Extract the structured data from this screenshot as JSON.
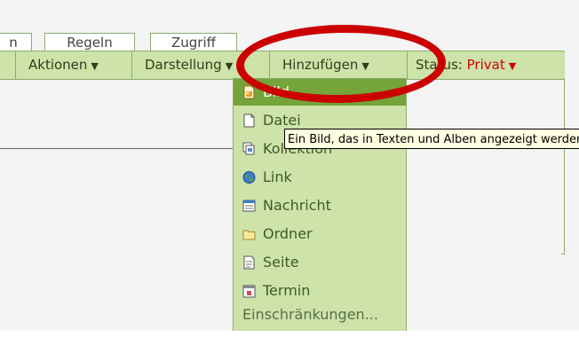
{
  "tabs": [
    {
      "label": "n"
    },
    {
      "label": "Regeln"
    },
    {
      "label": "Zugriff"
    }
  ],
  "menubar": {
    "aktionen": "Aktionen",
    "darstellung": "Darstellung",
    "hinzufuegen": "Hinzufügen",
    "status_label": "Status:",
    "status_value": "Privat",
    "arrow": "▼"
  },
  "dropdown": {
    "items": [
      {
        "label": "Bild",
        "icon": "image-file-icon"
      },
      {
        "label": "Datei",
        "icon": "file-icon"
      },
      {
        "label": "Kollektion",
        "icon": "collection-icon"
      },
      {
        "label": "Link",
        "icon": "globe-link-icon"
      },
      {
        "label": "Nachricht",
        "icon": "news-icon"
      },
      {
        "label": "Ordner",
        "icon": "folder-icon"
      },
      {
        "label": "Seite",
        "icon": "page-icon"
      },
      {
        "label": "Termin",
        "icon": "calendar-icon"
      }
    ],
    "restrictions": "Einschränkungen..."
  },
  "tooltip": {
    "text": "Ein Bild, das in Texten und Alben angezeigt werden kann."
  },
  "colors": {
    "menu_bg": "#cde3a9",
    "menu_border": "#8cac6c",
    "selected_bg": "#74a43a",
    "status_red": "#d40000",
    "annotation_red": "#cc0000",
    "tooltip_bg": "#ffffe1"
  }
}
